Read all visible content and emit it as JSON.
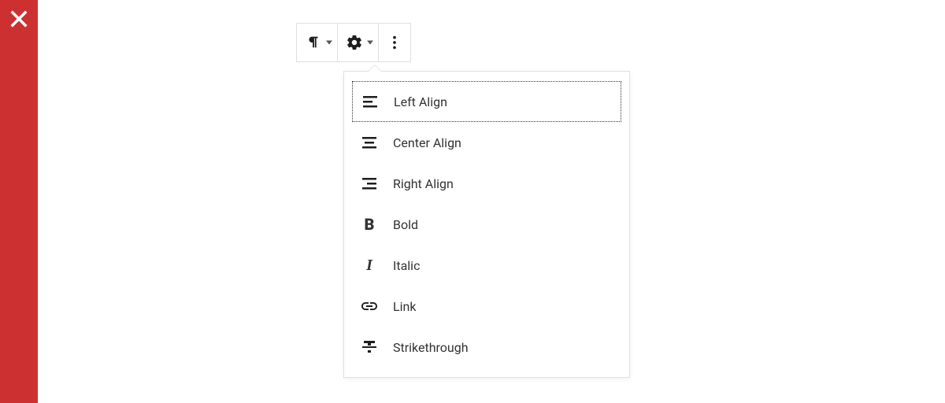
{
  "menu": {
    "items": [
      {
        "label": "Left Align"
      },
      {
        "label": "Center Align"
      },
      {
        "label": "Right Align"
      },
      {
        "label": "Bold"
      },
      {
        "label": "Italic"
      },
      {
        "label": "Link"
      },
      {
        "label": "Strikethrough"
      }
    ]
  }
}
